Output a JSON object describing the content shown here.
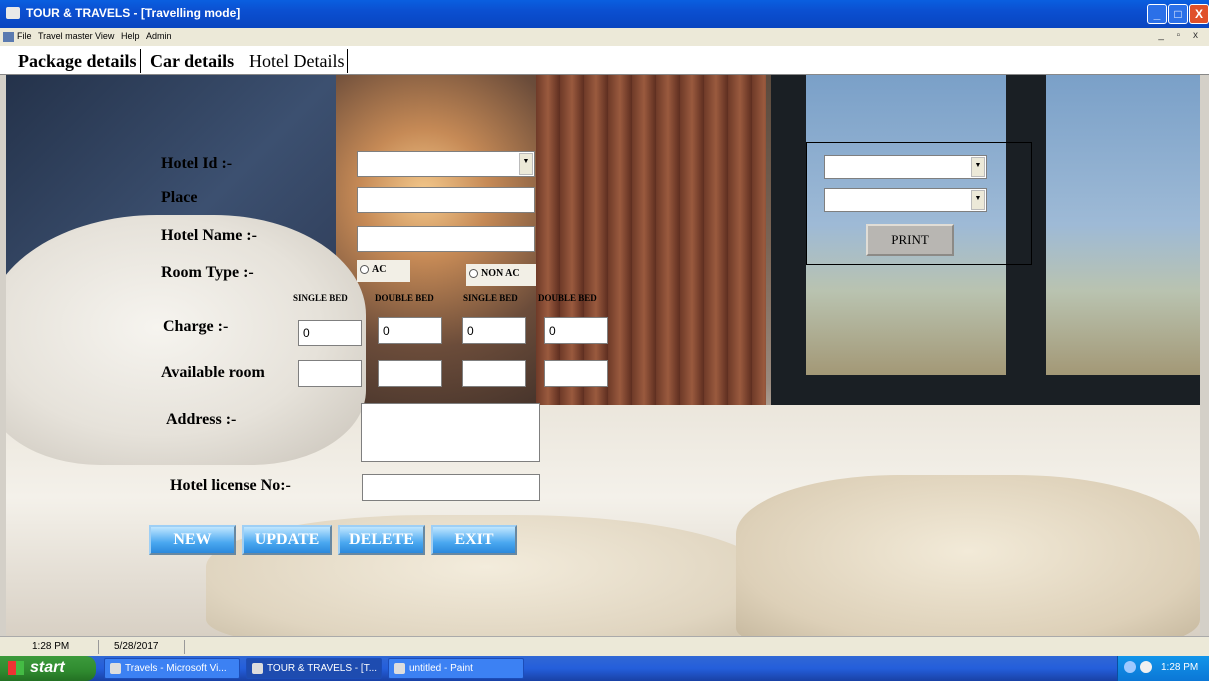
{
  "window": {
    "title": "TOUR & TRAVELS - [Travelling mode]",
    "buttons": {
      "minimize": "_",
      "maximize": "□",
      "close": "X"
    }
  },
  "menu": {
    "items": [
      "File",
      "Travel master",
      "View",
      "Help",
      "Admin"
    ],
    "mdi_controls": "_ ▫ x"
  },
  "tabs": [
    "Package details",
    "Car details",
    "Hotel Details"
  ],
  "form": {
    "hotel_id_label": "Hotel Id :-",
    "place_label": "Place",
    "hotel_name_label": "Hotel Name :-",
    "room_type_label": "Room Type :-",
    "ac_option": "AC",
    "non_ac_option": "NON AC",
    "bed_headers": [
      "SINGLE BED",
      "DOUBLE BED",
      "SINGLE BED",
      "DOUBLE BED"
    ],
    "charge_label": "Charge :-",
    "charge_values": [
      "0",
      "0",
      "0",
      "0"
    ],
    "available_room_label": "Available room",
    "available_values": [
      "",
      "",
      "",
      ""
    ],
    "address_label": "Address :-",
    "address_value": "",
    "license_label": "Hotel license No:-",
    "license_value": "",
    "hotel_id_value": "",
    "place_value": "",
    "hotel_name_value": ""
  },
  "buttons": {
    "new": "NEW",
    "update": "UPDATE",
    "delete": "DELETE",
    "exit": "EXIT"
  },
  "print_panel": {
    "combo1_value": "",
    "combo2_value": "",
    "print_label": "PRINT"
  },
  "status": {
    "time": "1:28 PM",
    "date": "5/28/2017"
  },
  "taskbar": {
    "start": "start",
    "tasks": [
      "Travels - Microsoft Vi...",
      "TOUR & TRAVELS - [T...",
      "untitled - Paint"
    ],
    "clock": "1:28 PM"
  },
  "colors": {
    "titlebar": "#0b4fd0",
    "button_blue": "#4aa8f0",
    "taskbar": "#245edb",
    "start_green": "#2f8a2f"
  }
}
